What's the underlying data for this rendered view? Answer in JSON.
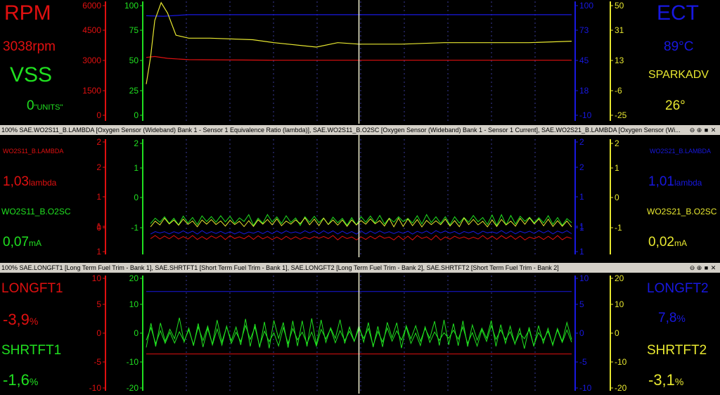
{
  "colors": {
    "red": "#e01010",
    "green": "#20e020",
    "blue": "#1818e0",
    "yellow": "#e8e830",
    "grid": "#3a3a9a",
    "cursor": "#f0f0d0"
  },
  "panels": {
    "p1": {
      "left": [
        {
          "text": "RPM",
          "color": "red"
        },
        {
          "value": "3038",
          "unit": "rpm",
          "color": "red"
        },
        {
          "text": "VSS",
          "color": "green"
        },
        {
          "value": "0",
          "unit": "\"UNITS\"",
          "color": "green"
        }
      ],
      "right": [
        {
          "text": "ECT",
          "color": "blue"
        },
        {
          "text": "89°C",
          "color": "blue"
        },
        {
          "text": "SPARKADV",
          "color": "yellow"
        },
        {
          "text": "26°",
          "color": "yellow"
        }
      ]
    },
    "p2": {
      "header": "100% SAE.WO2S11_B.LAMBDA [Oxygen Sensor (Wideband) Bank 1 - Sensor 1 Equivalence Ratio (lambda)], SAE.WO2S11_B.O2SC [Oxygen Sensor (Wideband) Bank 1 - Sensor 1 Current], SAE.WO2S21_B.LAMBDA [Oxygen Sensor (Wi...",
      "left": [
        {
          "text": "WO2S11_B.LAMBDA",
          "color": "red"
        },
        {
          "value": "1,03",
          "unit": "lambda",
          "color": "red"
        },
        {
          "text": "WO2S11_B.O2SC",
          "color": "green"
        },
        {
          "value": "0,07",
          "unit": "mA",
          "color": "green"
        }
      ],
      "right": [
        {
          "text": "WO2S21_B.LAMBDA",
          "color": "blue"
        },
        {
          "value": "1,01",
          "unit": "lambda",
          "color": "blue"
        },
        {
          "text": "WO2S21_B.O2SC",
          "color": "yellow"
        },
        {
          "value": "0,02",
          "unit": "mA",
          "color": "yellow"
        }
      ]
    },
    "p3": {
      "header": "100% SAE.LONGFT1 [Long Term Fuel Trim - Bank 1], SAE.SHRTFT1 [Short Term Fuel Trim - Bank 1], SAE.LONGFT2 [Long Term Fuel Trim - Bank 2], SAE.SHRTFT2 [Short Term Fuel Trim - Bank 2]",
      "left": [
        {
          "text": "LONGFT1",
          "color": "red"
        },
        {
          "value": "-3,9",
          "unit": "%",
          "color": "red"
        },
        {
          "text": "SHRTFT1",
          "color": "green"
        },
        {
          "value": "-1,6",
          "unit": "%",
          "color": "green"
        }
      ],
      "right": [
        {
          "text": "LONGFT2",
          "color": "blue"
        },
        {
          "value": "7,8",
          "unit": "%",
          "color": "blue"
        },
        {
          "text": "SHRTFT2",
          "color": "yellow"
        },
        {
          "value": "-3,1",
          "unit": "%",
          "color": "yellow"
        }
      ]
    }
  },
  "header_buttons": [
    "⊖",
    "⊕",
    "■",
    "✕"
  ],
  "chart_data": [
    {
      "type": "line",
      "axes": [
        {
          "color": "red",
          "ticks": [
            "6000",
            "4500",
            "3000",
            "1500",
            "0"
          ],
          "range": [
            0,
            6000
          ]
        },
        {
          "color": "green",
          "ticks": [
            "100",
            "75",
            "50",
            "25",
            "0"
          ],
          "range": [
            0,
            100
          ]
        },
        {
          "color": "blue",
          "ticks": [
            "100",
            "73",
            "45",
            "18",
            "-10"
          ],
          "range": [
            -10,
            100
          ]
        },
        {
          "color": "yellow",
          "ticks": [
            "50",
            "31",
            "13",
            "-6",
            "-25"
          ],
          "range": [
            -25,
            50
          ]
        }
      ],
      "series": [
        {
          "name": "RPM",
          "color": "red",
          "axis": 0,
          "t": [
            0,
            0.02,
            0.05,
            0.1,
            0.3,
            1
          ],
          "values": [
            3200,
            3250,
            3150,
            3080,
            3050,
            3050
          ]
        },
        {
          "name": "ECT",
          "color": "blue",
          "axis": 2,
          "t": [
            0,
            0.04,
            0.1,
            1
          ],
          "values": [
            90,
            89.5,
            91,
            91
          ]
        },
        {
          "name": "SPARKADV",
          "color": "yellow",
          "axis": 3,
          "t": [
            0,
            0.01,
            0.02,
            0.035,
            0.05,
            0.07,
            0.1,
            0.15,
            0.25,
            0.3,
            0.4,
            0.45,
            0.5,
            0.6,
            0.7,
            0.8,
            0.9,
            1
          ],
          "values": [
            -3,
            15,
            40,
            52,
            45,
            30,
            28,
            28,
            27,
            25,
            22,
            25,
            24,
            24,
            25,
            25,
            25,
            26
          ]
        },
        {
          "name": "VSS",
          "color": "green",
          "axis": 1,
          "t": [
            0,
            1
          ],
          "values": [
            0,
            0
          ]
        }
      ],
      "cursor_t": 0.5
    },
    {
      "type": "line",
      "axes": [
        {
          "color": "red",
          "ticks": [
            "2",
            "2",
            "1",
            "1",
            "0",
            "1"
          ],
          "range": [
            1.5,
            -1.5
          ]
        },
        {
          "color": "green",
          "ticks": [
            "2",
            "1",
            "0",
            "-1"
          ],
          "range": [
            -1,
            2
          ]
        },
        {
          "color": "blue",
          "ticks": [
            "2",
            "2",
            "1",
            "1",
            "1",
            "1"
          ],
          "range": [
            -1.5,
            1.5
          ]
        },
        {
          "color": "yellow",
          "ticks": [
            "2",
            "1",
            "0",
            "-1"
          ],
          "range": [
            -1,
            2
          ]
        }
      ],
      "series": [
        {
          "name": "WO2S11_B.LAMBDA",
          "color": "red",
          "axis": 1,
          "base": -0.65,
          "amp": 0.05,
          "seed": 3
        },
        {
          "name": "WO2S11_B.O2SC",
          "color": "green",
          "axis": 1,
          "base": -0.15,
          "amp": 0.12,
          "seed": 7
        },
        {
          "name": "WO2S21_B.LAMBDA",
          "color": "blue",
          "axis": 1,
          "base": -0.5,
          "amp": 0.04,
          "seed": 11
        },
        {
          "name": "WO2S21_B.O2SC",
          "color": "yellow",
          "axis": 1,
          "base": -0.22,
          "amp": 0.1,
          "seed": 17
        }
      ],
      "cursor_t": 0.5
    },
    {
      "type": "line",
      "axes": [
        {
          "color": "red",
          "ticks": [
            "10",
            "5",
            "0",
            "-5",
            "-10"
          ],
          "range": [
            -10,
            10
          ]
        },
        {
          "color": "green",
          "ticks": [
            "20",
            "10",
            "0",
            "-10",
            "-20"
          ],
          "range": [
            -20,
            20
          ]
        },
        {
          "color": "blue",
          "ticks": [
            "10",
            "5",
            "0",
            "-5",
            "-10"
          ],
          "range": [
            -10,
            10
          ]
        },
        {
          "color": "yellow",
          "ticks": [
            "20",
            "10",
            "0",
            "-10",
            "-20"
          ],
          "range": [
            -20,
            20
          ]
        }
      ],
      "series": [
        {
          "name": "LONGFT1",
          "color": "red",
          "axis": 0,
          "base": -3.9,
          "amp": 0,
          "seed": 1
        },
        {
          "name": "LONGFT2",
          "color": "blue",
          "axis": 0,
          "base": 7.8,
          "amp": 0,
          "seed": 2
        },
        {
          "name": "SHRTFT1",
          "color": "green",
          "axis": 1,
          "base": 0,
          "amp": 4.5,
          "seed": 5
        },
        {
          "name": "SHRTFT2",
          "color": "green",
          "axis": 1,
          "base": -1,
          "amp": 3,
          "seed": 9
        }
      ],
      "cursor_t": 0.5
    }
  ]
}
